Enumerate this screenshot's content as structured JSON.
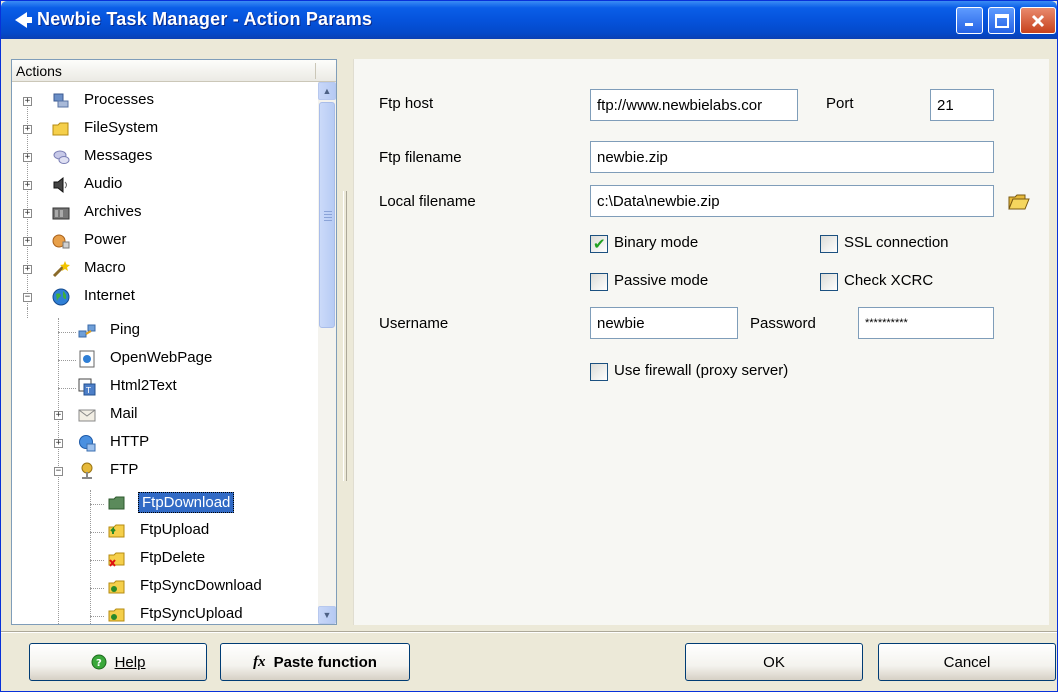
{
  "window": {
    "title": "Newbie Task Manager - Action Params"
  },
  "tree": {
    "header": "Actions",
    "items": [
      {
        "label": "Processes",
        "icon": "processes-icon"
      },
      {
        "label": "FileSystem",
        "icon": "folder-icon"
      },
      {
        "label": "Messages",
        "icon": "messages-icon"
      },
      {
        "label": "Audio",
        "icon": "speaker-icon"
      },
      {
        "label": "Archives",
        "icon": "archive-icon"
      },
      {
        "label": "Power",
        "icon": "power-icon"
      },
      {
        "label": "Macro",
        "icon": "macro-wand-icon"
      },
      {
        "label": "Internet",
        "icon": "globe-icon"
      },
      {
        "label": "Ping",
        "icon": "ping-icon"
      },
      {
        "label": "OpenWebPage",
        "icon": "webpage-icon"
      },
      {
        "label": "Html2Text",
        "icon": "html2text-icon"
      },
      {
        "label": "Mail",
        "icon": "envelope-icon"
      },
      {
        "label": "HTTP",
        "icon": "http-globe-icon"
      },
      {
        "label": "FTP",
        "icon": "ftp-icon"
      },
      {
        "label": "FtpDownload",
        "icon": "ftp-download-icon"
      },
      {
        "label": "FtpUpload",
        "icon": "ftp-upload-icon"
      },
      {
        "label": "FtpDelete",
        "icon": "ftp-delete-icon"
      },
      {
        "label": "FtpSyncDownload",
        "icon": "ftp-sync-download-icon"
      },
      {
        "label": "FtpSyncUpload",
        "icon": "ftp-sync-upload-icon"
      }
    ],
    "selected": "FtpDownload"
  },
  "form": {
    "ftp_host_label": "Ftp host",
    "ftp_host_value": "ftp://www.newbielabs.cor",
    "port_label": "Port",
    "port_value": "21",
    "ftp_filename_label": "Ftp filename",
    "ftp_filename_value": "newbie.zip",
    "local_filename_label": "Local filename",
    "local_filename_value": "c:\\Data\\newbie.zip",
    "binary_mode_label": "Binary mode",
    "ssl_label": "SSL connection",
    "passive_mode_label": "Passive mode",
    "check_xcrc_label": "Check XCRC",
    "username_label": "Username",
    "username_value": "newbie",
    "password_label": "Password",
    "password_value": "**********",
    "firewall_label": "Use firewall (proxy server)"
  },
  "buttons": {
    "help": "Help",
    "paste": "Paste function",
    "ok": "OK",
    "cancel": "Cancel"
  },
  "colors": {
    "titlebar": "#0553dc",
    "selection": "#316ac5",
    "check": "#21a121"
  }
}
